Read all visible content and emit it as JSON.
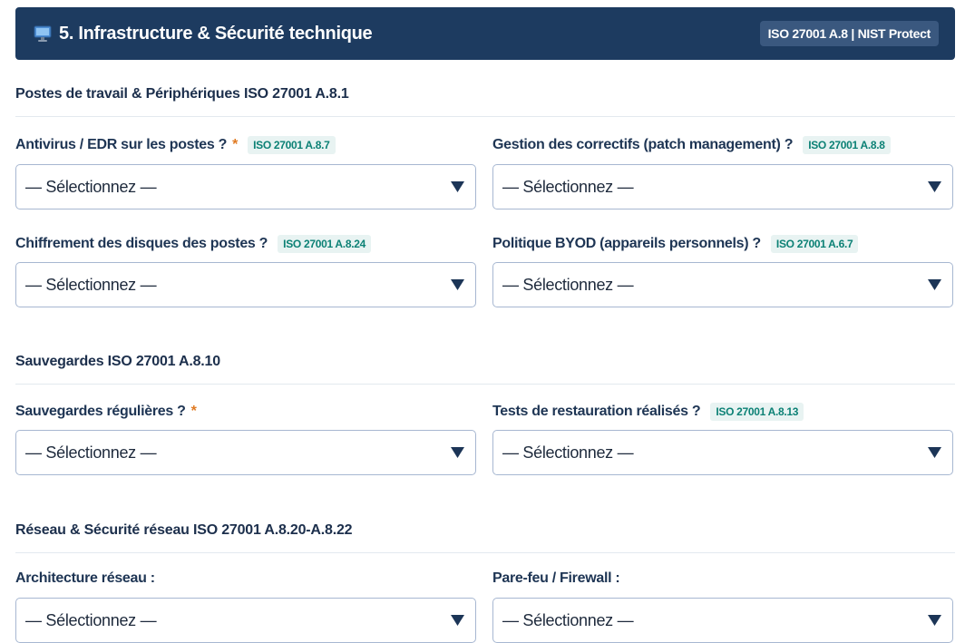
{
  "header": {
    "icon": "monitor-icon",
    "title": "5. Infrastructure & Sécurité technique",
    "badge": "ISO 27001 A.8 | NIST Protect"
  },
  "sections": [
    {
      "title": "Postes de travail & Périphériques ISO 27001 A.8.1",
      "fields": [
        {
          "label": "Antivirus / EDR sur les postes ?",
          "required": "*",
          "iso": "ISO 27001 A.8.7",
          "value": "— Sélectionnez —"
        },
        {
          "label": "Gestion des correctifs (patch management) ?",
          "iso": "ISO 27001 A.8.8",
          "value": "— Sélectionnez —"
        },
        {
          "label": "Chiffrement des disques des postes ?",
          "iso": "ISO 27001 A.8.24",
          "value": "— Sélectionnez —"
        },
        {
          "label": "Politique BYOD (appareils personnels) ?",
          "iso": "ISO 27001 A.6.7",
          "value": "— Sélectionnez —"
        }
      ]
    },
    {
      "title": "Sauvegardes ISO 27001 A.8.10",
      "fields": [
        {
          "label": "Sauvegardes régulières ?",
          "required": "*",
          "value": "— Sélectionnez —"
        },
        {
          "label": "Tests de restauration réalisés ?",
          "iso": "ISO 27001 A.8.13",
          "value": "— Sélectionnez —"
        }
      ]
    },
    {
      "title": "Réseau & Sécurité réseau ISO 27001 A.8.20-A.8.22",
      "fields": [
        {
          "label": "Architecture réseau :",
          "value": "— Sélectionnez —"
        },
        {
          "label": "Pare-feu / Firewall :",
          "value": "— Sélectionnez —"
        }
      ]
    }
  ],
  "colors": {
    "header_bg": "#1d3b60",
    "header_badge_bg": "#3a587f",
    "required": "#e07a22",
    "iso_tag_bg": "#e8f3f2",
    "iso_tag_text": "#0c8175",
    "select_border": "#a7b7d1"
  }
}
